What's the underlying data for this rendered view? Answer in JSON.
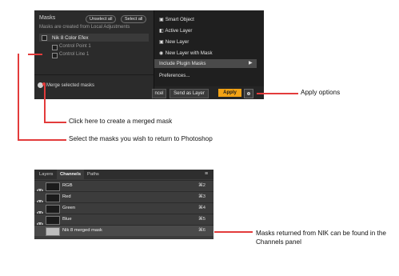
{
  "top_ui": {
    "masks_panel": {
      "title": "Masks",
      "unselect_all": "Unselect all",
      "select_all": "Select all",
      "subtitle": "Masks are created from Local Adjustments",
      "items": [
        {
          "label": "Nik 8 Color Efex"
        },
        {
          "label": "Control Point 1"
        },
        {
          "label": "Control Line 1"
        }
      ],
      "merge_label": "Merge selected masks"
    },
    "menu": {
      "items": [
        {
          "label": "Smart Object"
        },
        {
          "label": "Active Layer"
        },
        {
          "label": "New Layer"
        },
        {
          "label": "New Layer with Mask"
        },
        {
          "label": "Include Plugin Masks"
        },
        {
          "label": "Preferences..."
        }
      ],
      "submenu_arrow": "▶"
    },
    "buttons": {
      "cancel_fragment": "ncel",
      "send_as_layer": "Send as Layer",
      "apply": "Apply"
    }
  },
  "callouts": {
    "apply_options": "Apply options",
    "merged_mask": "Click here to create a merged mask",
    "select_masks": "Select the masks you wish to return to Photoshop",
    "masks_returned_line1": "Masks returned from NIK can be found in the",
    "masks_returned_line2": "Channels panel"
  },
  "channels_panel": {
    "tabs": [
      "Layers",
      "Channels",
      "Paths"
    ],
    "menu_icon": "≡",
    "rows": [
      {
        "label": "RGB",
        "shortcut": "⌘2"
      },
      {
        "label": "Red",
        "shortcut": "⌘3"
      },
      {
        "label": "Green",
        "shortcut": "⌘4"
      },
      {
        "label": "Blue",
        "shortcut": "⌘5"
      },
      {
        "label": "Nik 8 merged mask",
        "shortcut": "⌘6"
      }
    ]
  },
  "colors": {
    "callout_red": "#e33b3b",
    "apply_orange": "#f2a214"
  },
  "icons": {
    "eye": "eye-icon",
    "gear": "gear-icon",
    "menu": "hamburger-menu-icon",
    "arrow": "submenu-arrow-icon"
  }
}
